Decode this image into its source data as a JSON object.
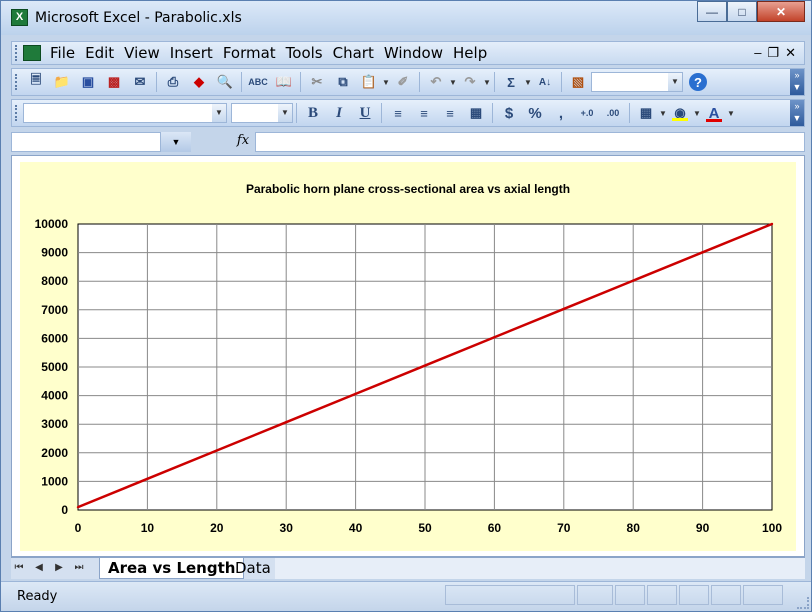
{
  "window": {
    "title": "Microsoft Excel - Parabolic.xls",
    "minimize_icon": "minimize-icon",
    "restore_icon": "restore-icon",
    "close_icon": "close-icon"
  },
  "menu": {
    "items": [
      "File",
      "Edit",
      "View",
      "Insert",
      "Format",
      "Tools",
      "Chart",
      "Window",
      "Help"
    ]
  },
  "toolbar": {
    "standard_icons": [
      "new-icon",
      "open-icon",
      "save-icon",
      "permission-icon",
      "mail-icon",
      "print-icon",
      "research-icon",
      "print-preview-icon",
      "spelling-icon",
      "research-book-icon",
      "cut-icon",
      "copy-icon",
      "paste-icon",
      "format-painter-icon",
      "undo-icon",
      "redo-icon",
      "autosum-icon",
      "sort-icon",
      "chart-wizard-icon",
      "help-icon"
    ],
    "zoom_value": "",
    "font_name": "",
    "font_size": "",
    "bold": "B",
    "italic": "I",
    "underline": "U",
    "currency": "$",
    "percent": "%",
    "comma": ",",
    "fill_color": "#ffff00",
    "font_color": "#e00000"
  },
  "formula_bar": {
    "name_box": "",
    "fx_label": "fx",
    "content": ""
  },
  "chart_data": {
    "type": "line",
    "title": "Parabolic horn plane cross-sectional area vs axial length",
    "xlabel": "",
    "ylabel": "",
    "xlim": [
      0,
      100
    ],
    "ylim": [
      0,
      10000
    ],
    "x_ticks": [
      0,
      10,
      20,
      30,
      40,
      50,
      60,
      70,
      80,
      90,
      100
    ],
    "y_ticks": [
      0,
      1000,
      2000,
      3000,
      4000,
      5000,
      6000,
      7000,
      8000,
      9000,
      10000
    ],
    "grid": true,
    "series": [
      {
        "color": "#cc0000",
        "x": [
          0,
          10,
          20,
          30,
          40,
          50,
          60,
          70,
          80,
          90,
          100
        ],
        "values": [
          100,
          1090,
          2080,
          3070,
          4060,
          5050,
          6040,
          7030,
          8020,
          9010,
          10000
        ]
      }
    ],
    "plot_background": "#ffffff",
    "chart_background": "#ffffcc"
  },
  "sheet_tabs": {
    "nav_icons": [
      "first-sheet-icon",
      "prev-sheet-icon",
      "next-sheet-icon",
      "last-sheet-icon"
    ],
    "tabs": [
      "Area vs Length",
      "Data"
    ],
    "active": "Area vs Length"
  },
  "status": {
    "text": "Ready"
  }
}
